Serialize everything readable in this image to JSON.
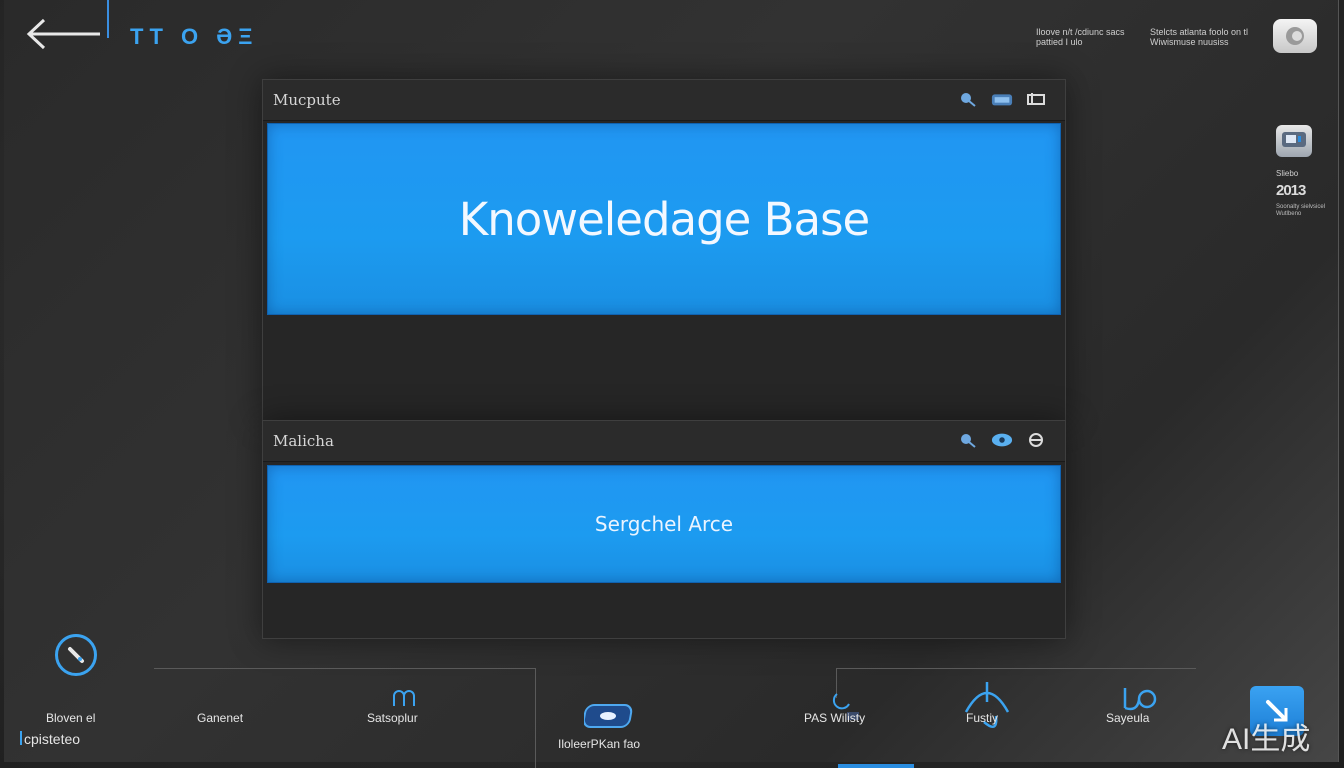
{
  "header": {
    "title": "TT O ƏΞ",
    "text_1": "Iloove n/t /cdiunc sacs pattied I ulo",
    "text_2": "Stelcts atlanta foolo on tl Wiwismuse nuusiss"
  },
  "sidebar": {
    "label": "Sliebo",
    "number": "2013",
    "description": "Soonalty sielvsicel Wutlbeno"
  },
  "panels": [
    {
      "title": "Mucpute",
      "banner_text": "Knoweledage Base"
    },
    {
      "title": "Malicha",
      "banner_text": "Sergchel Arce"
    }
  ],
  "bottom_nav": {
    "left_label_1": "Bloven el",
    "left_label_2": "cpisteteo",
    "items": [
      {
        "label": "Ganenet"
      },
      {
        "label": "Satsoplur"
      },
      {
        "label": "IloleerPKan fao"
      },
      {
        "label": "PAS Wilisty"
      },
      {
        "label": "Fustiy"
      },
      {
        "label": "Sayeula"
      }
    ]
  },
  "watermark": "AI生成",
  "colors": {
    "accent": "#3ba3f0",
    "banner": "#2196f3",
    "background": "#2c2c2c"
  }
}
